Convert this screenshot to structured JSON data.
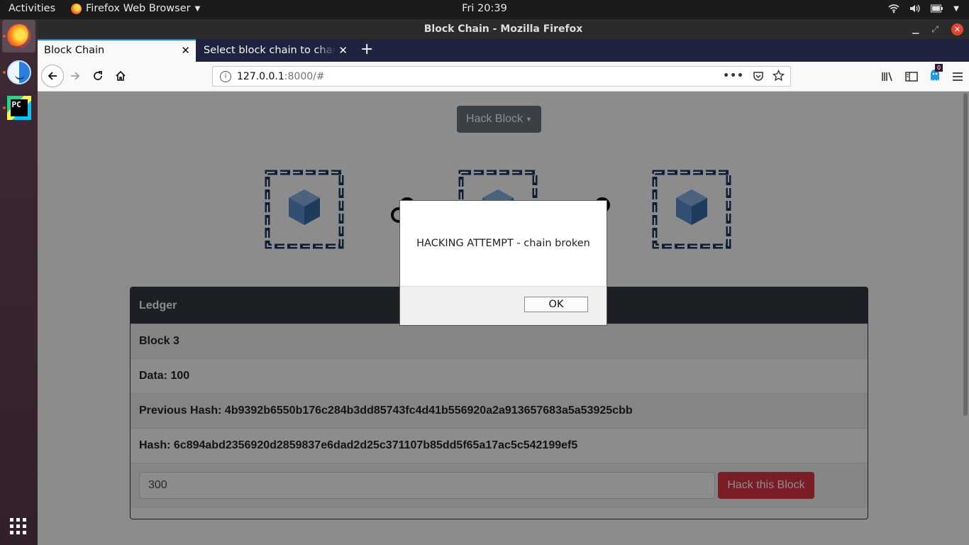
{
  "topbar": {
    "activities": "Activities",
    "app_name": "Firefox Web Browser",
    "clock": "Fri 20:39"
  },
  "dock": {
    "items": [
      "firefox-icon",
      "finder-icon",
      "pycharm-icon"
    ],
    "pycharm_text": "PC"
  },
  "window": {
    "title": "Block Chain - Mozilla Firefox"
  },
  "tabs": [
    {
      "label": "Block Chain"
    },
    {
      "label": "Select block chain to change"
    }
  ],
  "urlbar": {
    "host": "127.0.0.1",
    "path": ":8000/#"
  },
  "notifications_badge": "0",
  "page": {
    "hack_block_dropdown": "Hack Block",
    "ledger": {
      "header": "Ledger",
      "block": "Block 3",
      "data": "Data: 100",
      "previous_hash": "Previous Hash: 4b9392b6550b176c284b3dd85743fc4d41b556920a2a913657683a5a53925cbb",
      "hash": "Hash: 6c894abd2356920d2859837e6dad2d25c371107b85dd5f65a17ac5c542199ef5",
      "input_value": "300",
      "hack_button": "Hack this Block"
    }
  },
  "dialog": {
    "message": "HACKING ATTEMPT - chain broken",
    "ok": "OK"
  },
  "colors": {
    "accent": "#0a84ff",
    "danger": "#dc3545",
    "secondary": "#6c757d",
    "dark": "#343a40",
    "chain": "#1f3a63",
    "cube": "#4a7fc1"
  }
}
